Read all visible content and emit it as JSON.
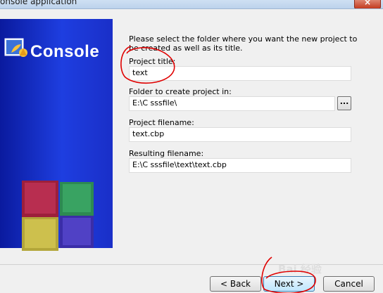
{
  "window": {
    "title": "onsole application"
  },
  "sidebar": {
    "logo_text": "Console"
  },
  "form": {
    "intro": "Please select the folder where you want the new project to be created as well as its title.",
    "project_title": {
      "label": "Project title:",
      "value": "text"
    },
    "folder": {
      "label": "Folder to create project in:",
      "value": "E:\\C sssfile\\",
      "browse_label": "..."
    },
    "project_filename": {
      "label": "Project filename:",
      "value": "text.cbp"
    },
    "resulting_filename": {
      "label": "Resulting filename:",
      "value": "E:\\C sssfile\\text\\text.cbp"
    }
  },
  "footer": {
    "back_label": "< Back",
    "next_label": "Next >",
    "cancel_label": "Cancel",
    "watermark": "Bai 经验"
  },
  "colors": {
    "side_panel": "#1e3ee0",
    "annotation": "#e00000"
  }
}
